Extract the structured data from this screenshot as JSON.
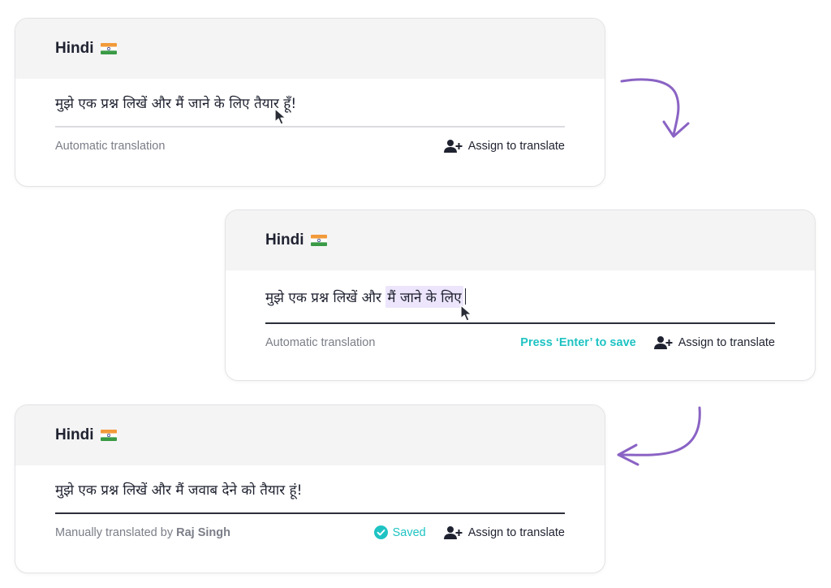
{
  "cards": [
    {
      "language": "Hindi",
      "text": "मुझे एक प्रश्न लिखें और मैं जाने के लिए तैयार हूँ!",
      "meta": "Automatic translation",
      "assign_label": "Assign to translate"
    },
    {
      "language": "Hindi",
      "text_prefix": "मुझे एक प्रश्न लिखें और",
      "text_selected": "मैं जाने के लिए",
      "meta": "Automatic translation",
      "hint": "Press ‘Enter’ to save",
      "assign_label": "Assign to translate"
    },
    {
      "language": "Hindi",
      "text": "मुझे एक प्रश्न लिखें और मैं जवाब देने को तैयार हूं!",
      "meta_prefix": "Manually translated by",
      "meta_author": "Raj Singh",
      "saved_label": "Saved",
      "assign_label": "Assign to translate"
    }
  ],
  "colors": {
    "accent": "#1fc3c3",
    "arrow": "#8a63c4",
    "selection": "#ece5fb",
    "header_bg": "#f4f4f5"
  },
  "icons": {
    "flag": "india-flag-icon",
    "assign": "add-user-icon",
    "saved": "check-circle-icon",
    "cursor": "mouse-pointer-icon"
  }
}
